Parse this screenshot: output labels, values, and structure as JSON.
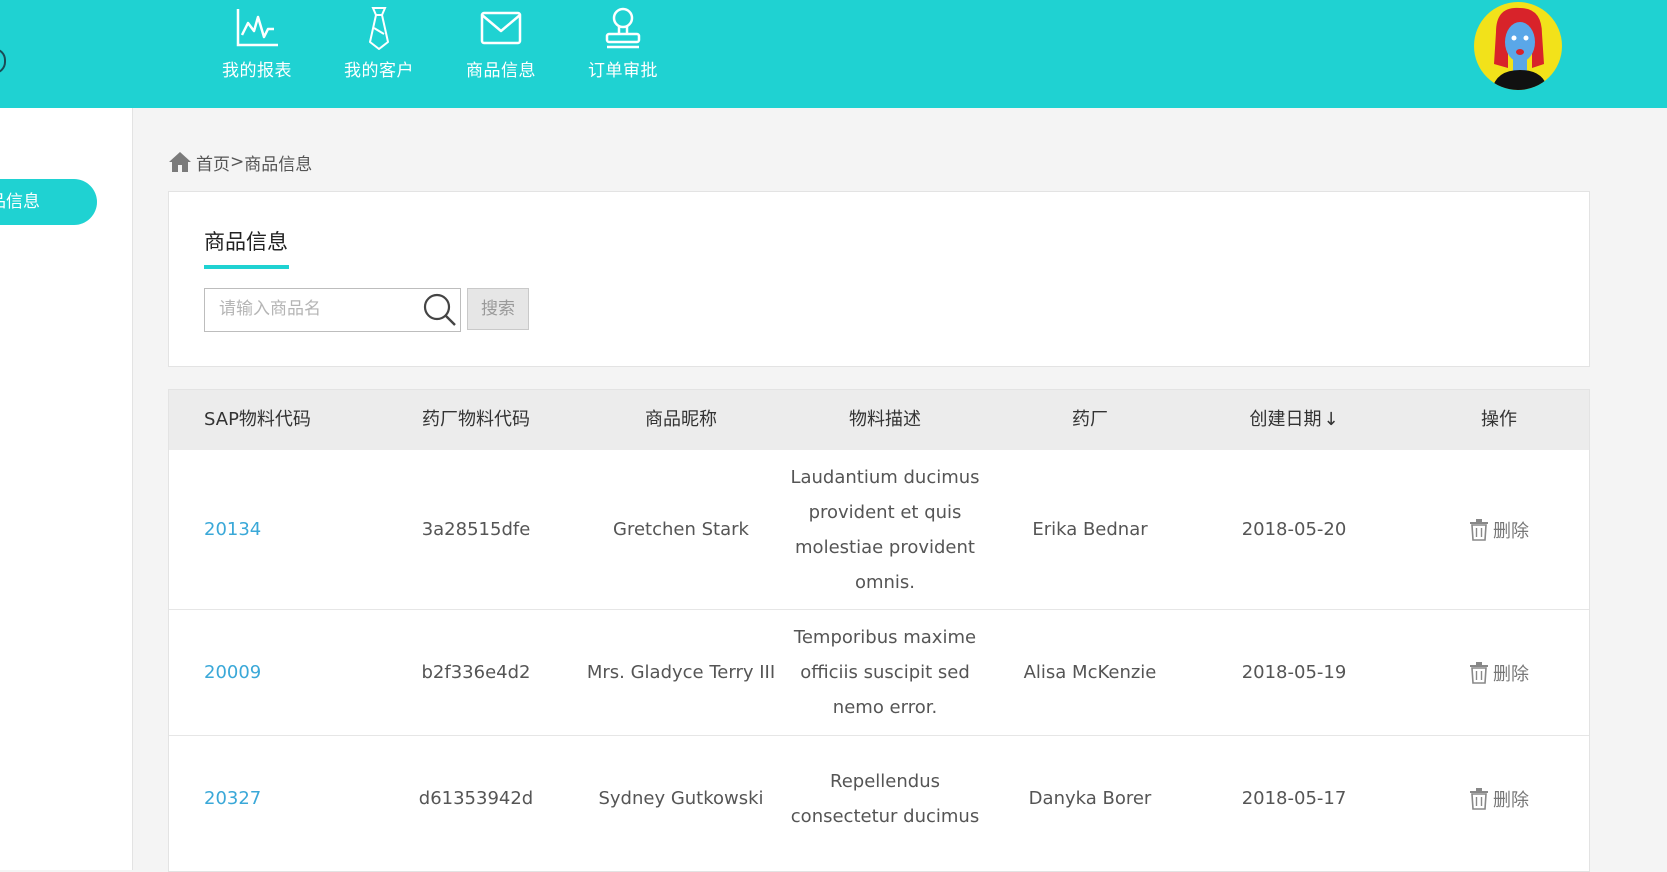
{
  "nav": {
    "items": [
      {
        "label": "我的报表",
        "icon": "line-chart-icon"
      },
      {
        "label": "我的客户",
        "icon": "tie-icon"
      },
      {
        "label": "商品信息",
        "icon": "mail-icon"
      },
      {
        "label": "订单审批",
        "icon": "stamp-icon"
      }
    ]
  },
  "sidebar": {
    "active_item": "品信息"
  },
  "breadcrumb": {
    "home": "首页",
    "separator": ">",
    "current": "商品信息"
  },
  "panel": {
    "title": "商品信息",
    "search_placeholder": "请输入商品名",
    "search_button": "搜索"
  },
  "table": {
    "columns": [
      "SAP物料代码",
      "药厂物料代码",
      "商品昵称",
      "物料描述",
      "药厂",
      "创建日期",
      "操作"
    ],
    "sort_indicator": "↓",
    "rows": [
      {
        "sap_code": "20134",
        "factory_code": "3a28515dfe",
        "nickname": "Gretchen Stark",
        "description": "Laudantium ducimus provident et quis molestiae provident omnis.",
        "factory": "Erika Bednar",
        "created": "2018-05-20",
        "action": "删除"
      },
      {
        "sap_code": "20009",
        "factory_code": "b2f336e4d2",
        "nickname": "Mrs. Gladyce Terry III",
        "description": "Temporibus maxime officiis suscipit sed nemo error.",
        "factory": "Alisa McKenzie",
        "created": "2018-05-19",
        "action": "删除"
      },
      {
        "sap_code": "20327",
        "factory_code": "d61353942d",
        "nickname": "Sydney Gutkowski",
        "description": "Repellendus consectetur ducimus",
        "factory": "Danyka Borer",
        "created": "2018-05-17",
        "action": "删除"
      }
    ]
  },
  "colors": {
    "accent": "#1fd2d2",
    "link": "#3aa8d8"
  }
}
